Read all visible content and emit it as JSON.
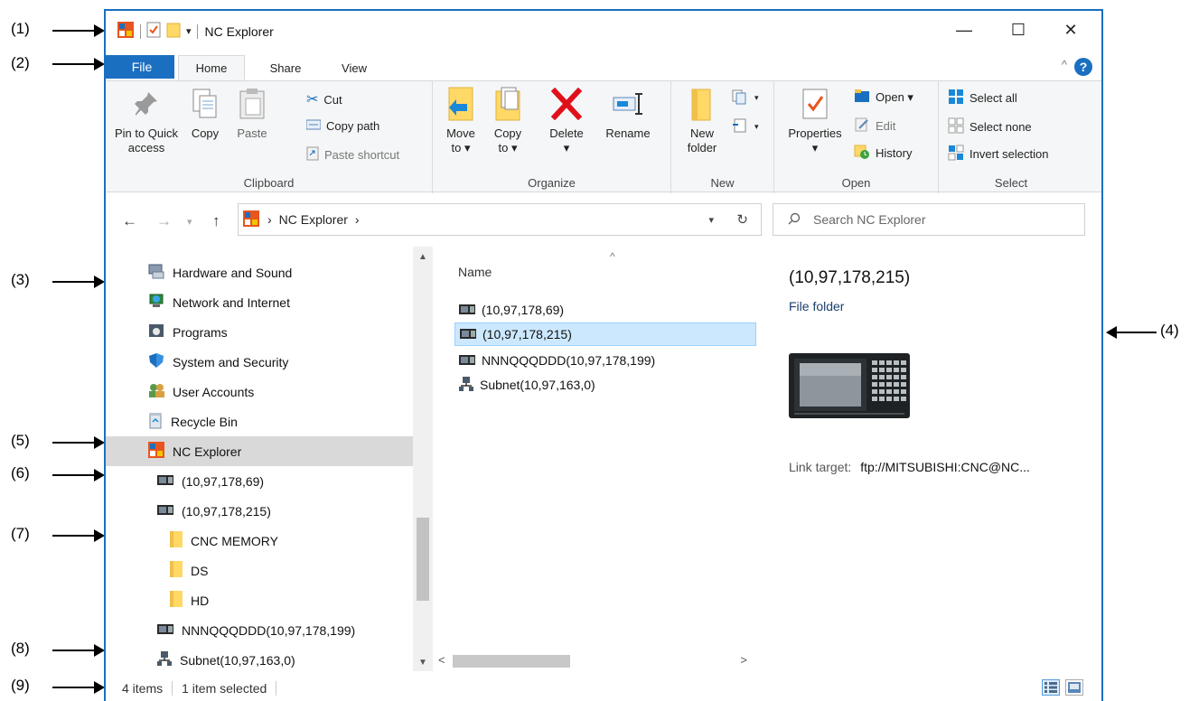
{
  "callouts": [
    "(1)",
    "(2)",
    "(3)",
    "(4)",
    "(5)",
    "(6)",
    "(7)",
    "(8)",
    "(9)"
  ],
  "window": {
    "title": "NC Explorer",
    "controls": {
      "minimize": "—",
      "maximize": "☐",
      "close": "✕"
    }
  },
  "tabs": {
    "file": "File",
    "home": "Home",
    "share": "Share",
    "view": "View",
    "help": "?"
  },
  "ribbon": {
    "clipboard": {
      "label": "Clipboard",
      "pin_line1": "Pin to Quick",
      "pin_line2": "access",
      "copy": "Copy",
      "paste": "Paste",
      "cut": "Cut",
      "copy_path": "Copy path",
      "paste_shortcut": "Paste shortcut"
    },
    "organize": {
      "label": "Organize",
      "move_line1": "Move",
      "move_line2": "to ▾",
      "copyto_line1": "Copy",
      "copyto_line2": "to ▾",
      "delete_line1": "Delete",
      "delete_line2": "▾",
      "rename": "Rename"
    },
    "new": {
      "label": "New",
      "folder_line1": "New",
      "folder_line2": "folder"
    },
    "open": {
      "label": "Open",
      "properties_line1": "Properties",
      "properties_line2": "▾",
      "open": "Open ▾",
      "edit": "Edit",
      "history": "History"
    },
    "select": {
      "label": "Select",
      "all": "Select all",
      "none": "Select none",
      "invert": "Invert selection"
    }
  },
  "address": {
    "path": "NC Explorer",
    "sep": "›",
    "search_placeholder": "Search NC Explorer"
  },
  "nav": {
    "items": [
      "Hardware and Sound",
      "Network and Internet",
      "Programs",
      "System and Security",
      "User Accounts",
      "Recycle Bin",
      "NC Explorer",
      "(10,97,178,69)",
      "(10,97,178,215)",
      "CNC MEMORY",
      "DS",
      "HD",
      "NNNQQQDDD(10,97,178,199)",
      "Subnet(10,97,163,0)"
    ]
  },
  "files": {
    "column_name": "Name",
    "items": [
      "(10,97,178,69)",
      "(10,97,178,215)",
      "NNNQQQDDD(10,97,178,199)",
      "Subnet(10,97,163,0)"
    ]
  },
  "preview": {
    "title": "(10,97,178,215)",
    "type": "File folder",
    "link_label": "Link target:",
    "link_value": "ftp://MITSUBISHI:CNC@NC..."
  },
  "status": {
    "count": "4 items",
    "selected": "1 item selected"
  },
  "colors": {
    "accent": "#1a6fc0",
    "selection": "#cce8ff",
    "nav_selected": "#d9d9d9"
  }
}
